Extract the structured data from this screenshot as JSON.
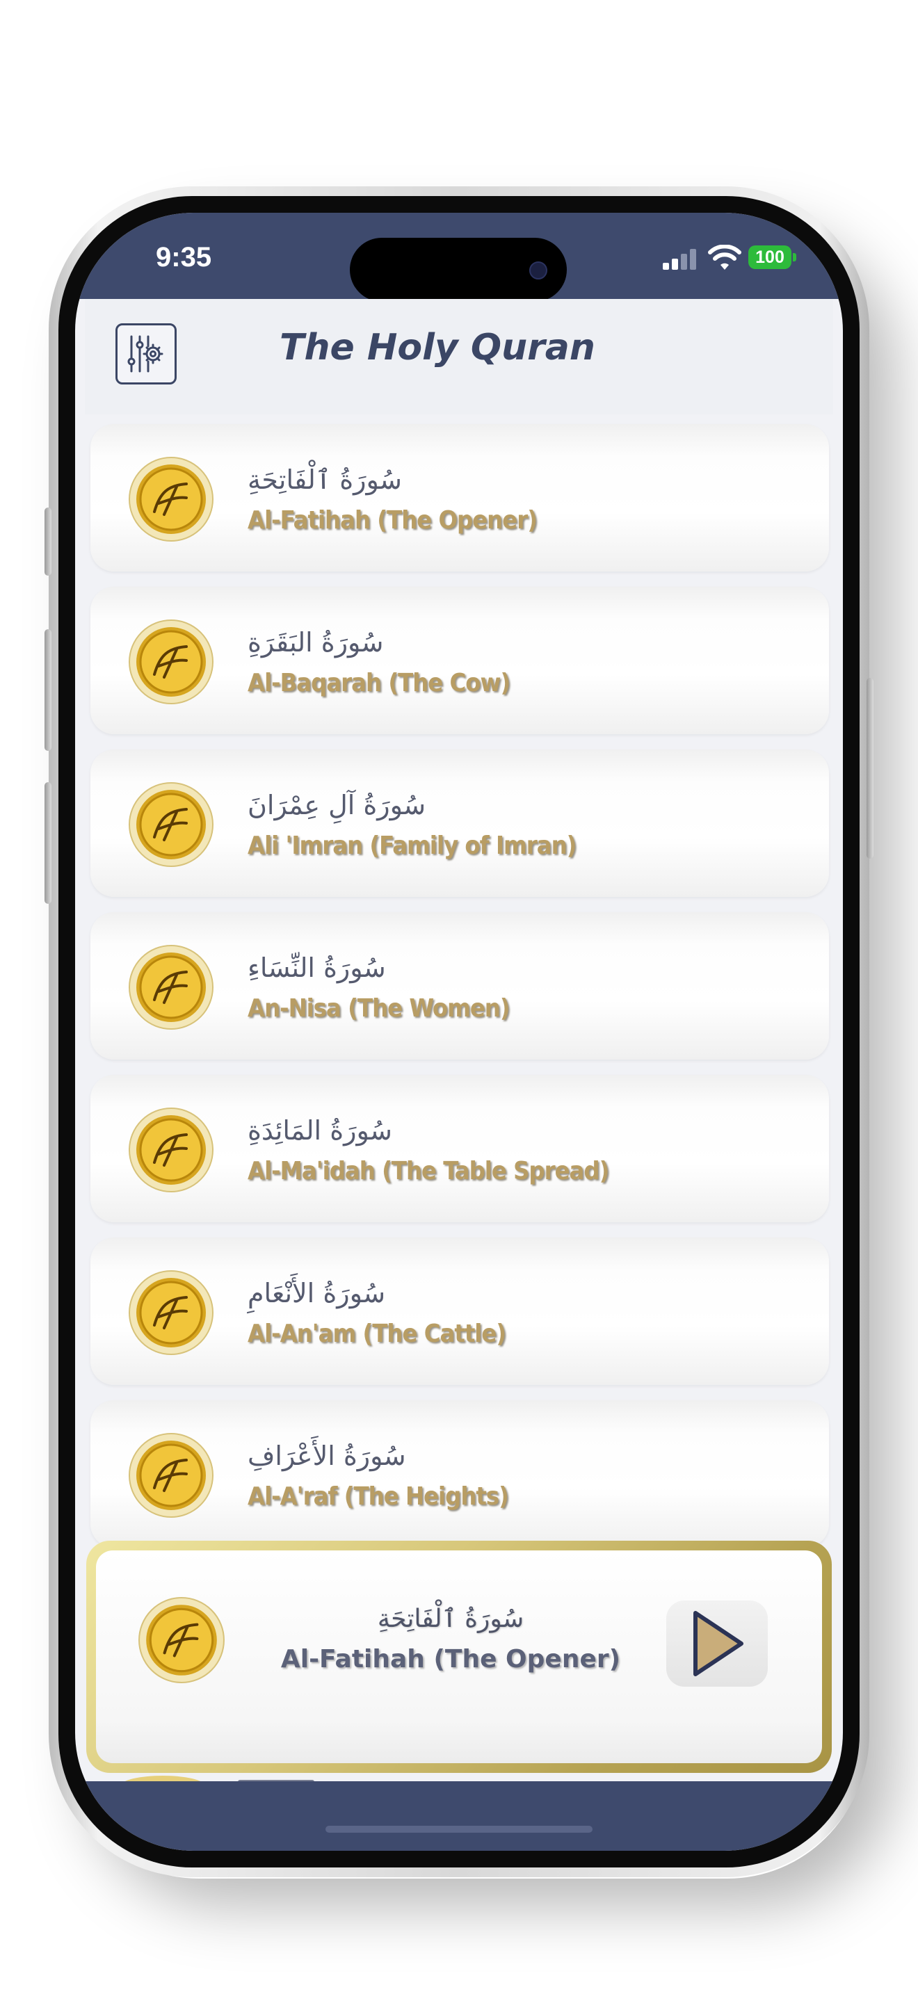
{
  "status_bar": {
    "time": "9:35",
    "battery": "100",
    "colors": {
      "bar": "#3e4a6d",
      "battery": "#2dbb3b"
    }
  },
  "header": {
    "title": "The Holy Quran",
    "settings_icon": "sliders-gear-icon"
  },
  "surahs": [
    {
      "arabic": "سُورَةُ ٱلْفَاتِحَةِ",
      "english": "Al-Fatihah (The Opener)"
    },
    {
      "arabic": "سُورَةُ البَقَرَةِ",
      "english": "Al-Baqarah (The Cow)"
    },
    {
      "arabic": "سُورَةُ آلِ عِمْرَانَ",
      "english": "Ali 'Imran (Family of Imran)"
    },
    {
      "arabic": "سُورَةُ النِّسَاءِ",
      "english": "An-Nisa (The Women)"
    },
    {
      "arabic": "سُورَةُ المَائِدَةِ",
      "english": "Al-Ma'idah (The Table Spread)"
    },
    {
      "arabic": "سُورَةُ الأَنْعَامِ",
      "english": "Al-An'am (The Cattle)"
    },
    {
      "arabic": "سُورَةُ الأَعْرَافِ",
      "english": "Al-A'raf (The Heights)"
    }
  ],
  "player": {
    "arabic": "سُورَةُ ٱلْفَاتِحَةِ",
    "english": "Al-Fatihah (The Opener)",
    "play_icon": "play-icon"
  },
  "colors": {
    "primary": "#3e4a6d",
    "gold_text": "#b89d64",
    "gold_border": "#c9b86a"
  }
}
